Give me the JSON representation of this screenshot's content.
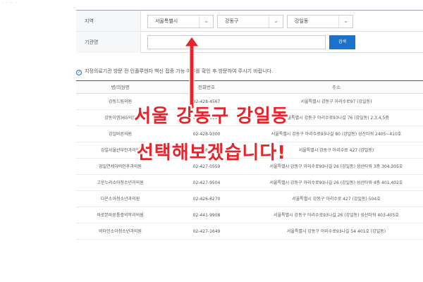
{
  "breadcrumb": "· · · ·",
  "form": {
    "region_label": "지역",
    "city_value": "서울특별시",
    "district_value": "강동구",
    "dong_value": "강일동",
    "org_label": "기관명",
    "org_value": "",
    "search_label": "검색"
  },
  "notice": "지정의료기관 방문 전 인플루엔자 백신 접종 가능 여부를 확인 후 방문하여 주시기 바랍니다.",
  "table": {
    "headers": [
      "병/의원명",
      "전화번호",
      "주소"
    ],
    "rows": [
      {
        "name": "강동드림의원",
        "phone": "02-428-4567",
        "addr": "서울특별시 강동구 아리수로97 (강일동)"
      },
      {
        "name": "강동이엠365의원",
        "phone": "02-428-9111",
        "addr": "서울특별시 강동구 아리수로93나길 76 (강일동) 2,3,4,5층"
      },
      {
        "name": "강일바른의원",
        "phone": "02-428-9300",
        "addr": "서울특별시 강동구 아리수로93나길 80 (강일동) 성산타워 2405~410호"
      },
      {
        "name": "강일서울산부인과의원",
        "phone": "02-428-0924",
        "addr": "서울특별시 강동구 아리수로 427 (강일동)"
      },
      {
        "name": "강일연세이비인후과의원",
        "phone": "02-427-0559",
        "addr": "서울특별시 강동구 아리수로93나길 26 (강일동) 성산타워 3층 304,305호"
      },
      {
        "name": "고운누리소아청소년과의원",
        "phone": "02-427-9504",
        "addr": "서울특별시 강동구 아리수로93나길 26 (강일동) 성산타워 4층 401,402호"
      },
      {
        "name": "다온소아청소년과의원",
        "phone": "02-426-8270",
        "addr": "서울특별시 강동구 아리수로 427 (강일동) 504호"
      },
      {
        "name": "바로본바른통증의학과의원",
        "phone": "02-441-9908",
        "addr": "서울특별시 강동구 아리수로93나길 26 (강일동) 성산타워 403-405호"
      },
      {
        "name": "비타민소아청소년과의원",
        "phone": "02-427-1649",
        "addr": "서울특별시 강동구 아리수로93나길 54 401호 (강일동)"
      }
    ]
  },
  "overlay": {
    "line1": "서울 강동구 강일동",
    "line2": "선택해보겠습니다!"
  },
  "colors": {
    "accent": "#1a73c9",
    "annotation": "#e8232a"
  }
}
